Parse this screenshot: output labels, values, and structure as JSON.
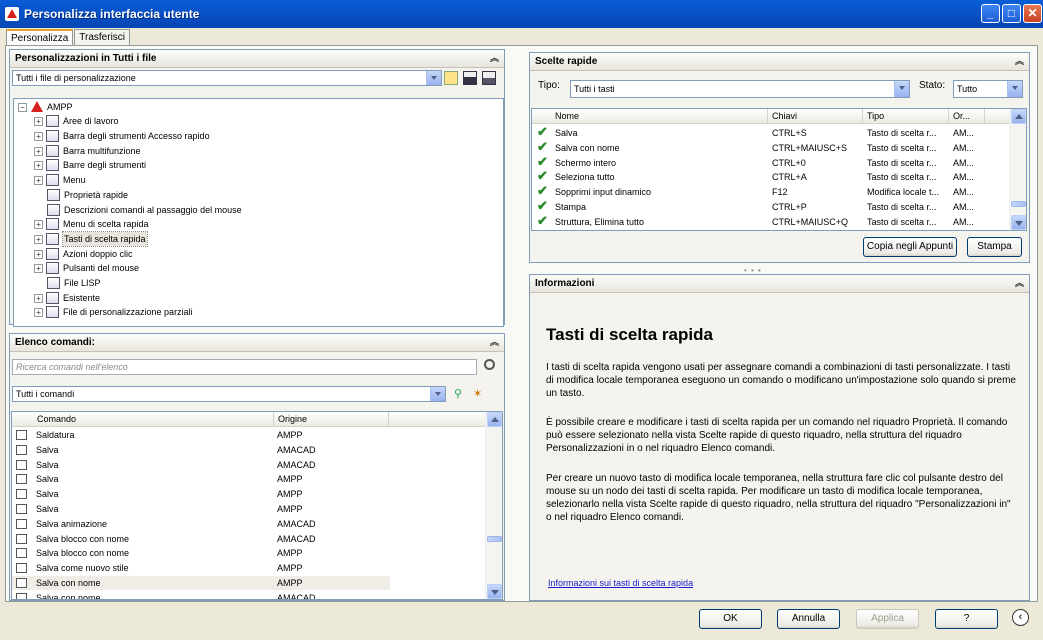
{
  "window": {
    "title": "Personalizza interfaccia utente"
  },
  "tabs": [
    {
      "label": "Personalizza",
      "active": true
    },
    {
      "label": "Trasferisci",
      "active": false
    }
  ],
  "customizations": {
    "header": "Personalizzazioni in Tutti i file",
    "file_select": "Tutti i file di personalizzazione",
    "tree": [
      {
        "label": "AMPP",
        "level": 0,
        "expander": "−"
      },
      {
        "label": "Aree di lavoro",
        "level": 1,
        "expander": "+"
      },
      {
        "label": "Barra degli strumenti Accesso rapido",
        "level": 1,
        "expander": "+"
      },
      {
        "label": "Barra multifunzione",
        "level": 1,
        "expander": "+"
      },
      {
        "label": "Barre degli strumenti",
        "level": 1,
        "expander": "+"
      },
      {
        "label": "Menu",
        "level": 1,
        "expander": "+"
      },
      {
        "label": "Proprietà rapide",
        "level": 1,
        "expander": ""
      },
      {
        "label": "Descrizioni comandi al passaggio del mouse",
        "level": 1,
        "expander": ""
      },
      {
        "label": "Menu di scelta rapida",
        "level": 1,
        "expander": "+"
      },
      {
        "label": "Tasti di scelta rapida",
        "level": 1,
        "expander": "+",
        "selected": true
      },
      {
        "label": "Azioni doppio clic",
        "level": 1,
        "expander": "+"
      },
      {
        "label": "Pulsanti del mouse",
        "level": 1,
        "expander": "+"
      },
      {
        "label": "File LISP",
        "level": 1,
        "expander": ""
      },
      {
        "label": "Esistente",
        "level": 1,
        "expander": "+"
      },
      {
        "label": "File di personalizzazione parziali",
        "level": 1,
        "expander": "+"
      }
    ]
  },
  "commands": {
    "header": "Elenco comandi:",
    "search_placeholder": "Ricerca comandi nell'elenco",
    "filter": "Tutti i comandi",
    "columns": {
      "command": "Comando",
      "origin": "Origine"
    },
    "rows": [
      {
        "name": "Saldatura",
        "origin": "AMPP"
      },
      {
        "name": "Salva",
        "origin": "AMACAD"
      },
      {
        "name": "Salva",
        "origin": "AMACAD"
      },
      {
        "name": "Salva",
        "origin": "AMPP"
      },
      {
        "name": "Salva",
        "origin": "AMPP"
      },
      {
        "name": "Salva",
        "origin": "AMPP"
      },
      {
        "name": "Salva animazione",
        "origin": "AMACAD"
      },
      {
        "name": "Salva blocco con nome",
        "origin": "AMACAD"
      },
      {
        "name": "Salva blocco con nome",
        "origin": "AMPP"
      },
      {
        "name": "Salva come nuovo stile",
        "origin": "AMPP"
      },
      {
        "name": "Salva con nome",
        "origin": "AMPP",
        "highlight": true
      },
      {
        "name": "Salva con nome",
        "origin": "AMACAD"
      }
    ]
  },
  "shortcuts": {
    "header": "Scelte rapide",
    "type_label": "Tipo:",
    "type_value": "Tutti i tasti",
    "state_label": "Stato:",
    "state_value": "Tutto",
    "columns": {
      "name": "Nome",
      "keys": "Chiavi",
      "type": "Tipo",
      "origin": "Or..."
    },
    "rows": [
      {
        "name": "Salva",
        "keys": "CTRL+S",
        "type": "Tasto di scelta r...",
        "origin": "AM..."
      },
      {
        "name": "Salva con nome",
        "keys": "CTRL+MAIUSC+S",
        "type": "Tasto di scelta r...",
        "origin": "AM..."
      },
      {
        "name": "Schermo intero",
        "keys": "CTRL+0",
        "type": "Tasto di scelta r...",
        "origin": "AM..."
      },
      {
        "name": "Seleziona tutto",
        "keys": "CTRL+A",
        "type": "Tasto di scelta r...",
        "origin": "AM..."
      },
      {
        "name": "Sopprimi input dinamico",
        "keys": "F12",
        "type": "Modifica locale t...",
        "origin": "AM..."
      },
      {
        "name": "Stampa",
        "keys": "CTRL+P",
        "type": "Tasto di scelta r...",
        "origin": "AM..."
      },
      {
        "name": "Struttura, Elimina tutto",
        "keys": "CTRL+MAIUSC+Q",
        "type": "Tasto di scelta r...",
        "origin": "AM..."
      }
    ],
    "copy_button": "Copia negli Appunti",
    "print_button": "Stampa"
  },
  "info": {
    "header": "Informazioni",
    "title": "Tasti di scelta rapida",
    "paragraphs": [
      "I tasti di scelta rapida vengono usati per assegnare comandi a combinazioni di tasti personalizzate. I tasti di modifica locale temporanea eseguono un comando o modificano un'impostazione solo quando si preme un tasto.",
      "È possibile creare e modificare i tasti di scelta rapida per un comando nel riquadro Proprietà. Il comando può essere selezionato nella vista Scelte rapide di questo riquadro, nella struttura del riquadro Personalizzazioni in o nel riquadro Elenco comandi.",
      "Per creare un nuovo tasto di modifica locale temporanea, nella struttura fare clic col pulsante destro del mouse su un nodo dei tasti di scelta rapida. Per modificare un tasto di modifica locale temporanea, selezionarlo nella vista Scelte rapide di questo riquadro, nella struttura del riquadro \"Personalizzazioni in\" o nel riquadro Elenco comandi."
    ],
    "link": "Informazioni sui tasti di scelta rapida"
  },
  "footer": {
    "ok": "OK",
    "cancel": "Annulla",
    "apply": "Applica",
    "help": "?"
  }
}
